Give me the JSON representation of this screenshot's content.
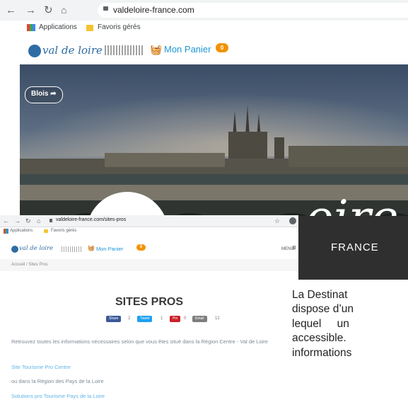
{
  "main_browser": {
    "url": "valdeloire-france.com",
    "nav_icons": [
      "back-arrow-icon",
      "forward-arrow-icon",
      "reload-icon",
      "home-icon",
      "lock-icon"
    ],
    "bookmarks": [
      {
        "label": "Applications",
        "icon": "apps-grid-icon"
      },
      {
        "label": "Favoris gérés",
        "icon": "folder-icon"
      }
    ]
  },
  "site_header": {
    "logo_text": "val de loire",
    "cart_label": "Mon Panier",
    "cart_count": "0"
  },
  "hero": {
    "location_button": "Blois",
    "overlay_word": "oire",
    "overlay_country": "FRANCE"
  },
  "small_browser": {
    "url": "valdeloire-france.com/sites-pros",
    "bookmarks": [
      "Applications",
      "Favoris gérés"
    ],
    "cart_label": "Mon Panier",
    "cart_count": "0",
    "menu_label": "MENU",
    "breadcrumb": "Accueil / Sites Pros",
    "page_title": "SITES PROS",
    "share_buttons": [
      {
        "label": "Share",
        "count": "2",
        "color": "#3b5998"
      },
      {
        "label": "Tweet",
        "count": "1",
        "color": "#1da1f2"
      },
      {
        "label": "Pin",
        "count": "0",
        "color": "#cb2027"
      },
      {
        "label": "Email",
        "count": "12",
        "color": "#7d7d7d"
      }
    ],
    "intro_text": "Retrouvez toutes les informations nécessaires selon que vous êtes situé dans la Région Centre - Val de Loire",
    "link1": "Site Tourisme Pro Centre",
    "text2": "ou dans la Région des Pays de la Loire",
    "link2": "Solutions pro Tourisme Pays de la Loire"
  },
  "side_text": {
    "line1": "La Destinat",
    "line2": "dispose d’un",
    "line3": "lequel un",
    "line4": "accessible.",
    "line5": "informations"
  }
}
